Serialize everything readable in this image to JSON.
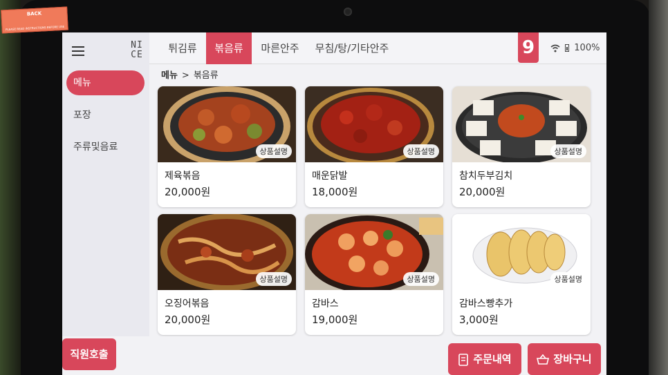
{
  "sticker": {
    "title": "BACK",
    "fine_print": "PLEASE READ INSTRUCTIONS BEFORE USE"
  },
  "sidebar": {
    "logo": "NICE",
    "items": [
      {
        "label": "메뉴",
        "active": true
      },
      {
        "label": "포장",
        "active": false
      },
      {
        "label": "주류및음료",
        "active": false
      }
    ]
  },
  "tabs": [
    {
      "label": "튀김류",
      "active": false
    },
    {
      "label": "볶음류",
      "active": true
    },
    {
      "label": "마른안주",
      "active": false
    },
    {
      "label": "무침/탕/기타안주",
      "active": false
    }
  ],
  "table_number": "9",
  "status": {
    "battery": "100%"
  },
  "breadcrumb": {
    "root": "메뉴",
    "separator": ">",
    "current": "볶음류"
  },
  "menu_items": [
    {
      "name": "제육볶음",
      "price": "20,000원",
      "badge": "상품설명"
    },
    {
      "name": "매운닭발",
      "price": "18,000원",
      "badge": "상품설명"
    },
    {
      "name": "참치두부김치",
      "price": "20,000원",
      "badge": "상품설명"
    },
    {
      "name": "오징어볶음",
      "price": "20,000원",
      "badge": "상품설명"
    },
    {
      "name": "감바스",
      "price": "19,000원",
      "badge": "상품설명"
    },
    {
      "name": "감바스빵추가",
      "price": "3,000원",
      "badge": "상품설명"
    }
  ],
  "buttons": {
    "staff_call": "직원호출",
    "order_history": "주문내역",
    "cart": "장바구니"
  },
  "colors": {
    "accent": "#d8475b",
    "sidebar_bg": "#e9e9ef",
    "screen_bg": "#f2f2f5"
  }
}
